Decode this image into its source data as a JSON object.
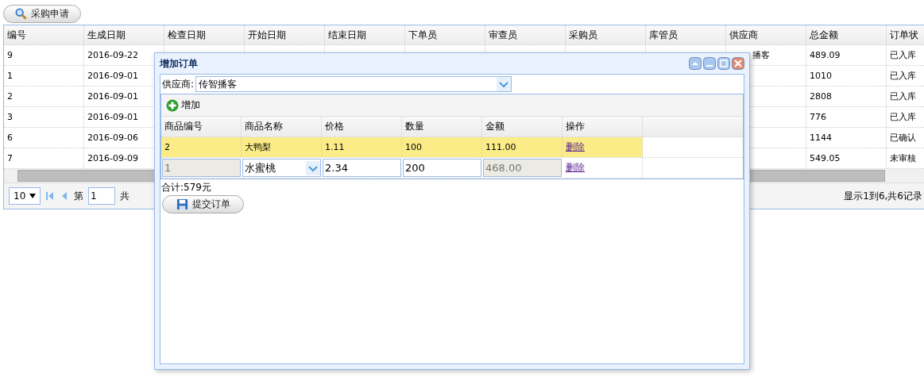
{
  "search_button": {
    "label": "采购申请"
  },
  "grid": {
    "columns": [
      "编号",
      "生成日期",
      "检查日期",
      "开始日期",
      "结束日期",
      "下单员",
      "审查员",
      "采购员",
      "库管员",
      "供应商",
      "总金额",
      "订单状"
    ],
    "rows": [
      {
        "cells": [
          "9",
          "2016-09-22"
        ],
        "tail": [
          "播客",
          "489.09",
          "已入库"
        ]
      },
      {
        "cells": [
          "1",
          "2016-09-01"
        ],
        "tail": [
          "1010",
          "已入库"
        ]
      },
      {
        "cells": [
          "2",
          "2016-09-01"
        ],
        "tail": [
          "2808",
          "已入库"
        ]
      },
      {
        "cells": [
          "3",
          "2016-09-01"
        ],
        "tail": [
          "776",
          "已入库"
        ]
      },
      {
        "cells": [
          "6",
          "2016-09-06"
        ],
        "tail": [
          "1144",
          "已确认"
        ]
      },
      {
        "cells": [
          "7",
          "2016-09-09"
        ],
        "tail": [
          "549.05",
          "未审核"
        ]
      }
    ]
  },
  "pager": {
    "page_size": "10",
    "page_label": "第",
    "page": "1",
    "total_prefix": "共",
    "summary": "显示1到6,共6记录"
  },
  "dialog": {
    "title": "增加订单",
    "supplier": {
      "label": "供应商:",
      "value": "传智播客"
    },
    "add_button": "增加",
    "columns": [
      "商品编号",
      "商品名称",
      "价格",
      "数量",
      "金额",
      "操作"
    ],
    "rows": [
      {
        "kind": "view",
        "selected": true,
        "cells": [
          "2",
          "大鸭梨",
          "1.11",
          "100",
          "111.00"
        ],
        "action": "删除"
      },
      {
        "kind": "edit",
        "selected": false,
        "cells": [
          "1",
          "水蜜桃",
          "2.34",
          "200",
          "468.00"
        ],
        "action": "删除"
      }
    ],
    "total": "合计:579元",
    "submit": "提交订单"
  }
}
